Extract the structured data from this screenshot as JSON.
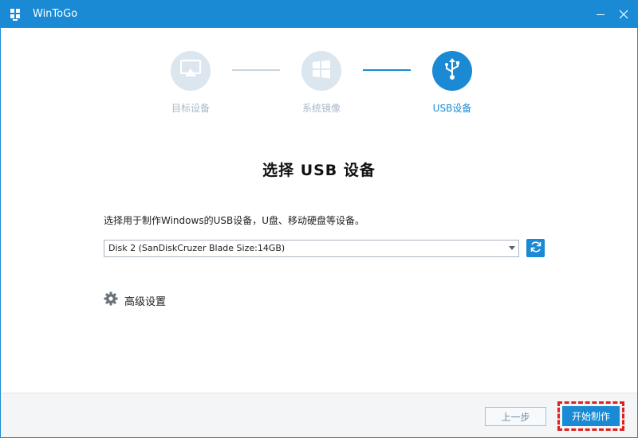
{
  "window": {
    "title": "WinToGo",
    "accent_color": "#1a8ad4",
    "icons": {
      "app": "windows-logo-icon",
      "minimize": "minimize-icon",
      "close": "close-icon"
    }
  },
  "steps": [
    {
      "label": "目标设备",
      "icon": "monitor-icon",
      "state": "done"
    },
    {
      "label": "系统镜像",
      "icon": "windows-logo-icon",
      "state": "done"
    },
    {
      "label": "USB设备",
      "icon": "usb-icon",
      "state": "active"
    }
  ],
  "main": {
    "heading": "选择 USB 设备",
    "instruction": "选择用于制作Windows的USB设备，U盘、移动硬盘等设备。",
    "device_dropdown": {
      "selected": "Disk 2 (SanDiskCruzer Blade Size:14GB)"
    },
    "refresh_icon": "refresh-icon",
    "advanced": {
      "label": "高级设置",
      "icon": "gear-icon"
    }
  },
  "footer": {
    "prev_label": "上一步",
    "start_label": "开始制作",
    "highlight_color": "#e02020"
  }
}
